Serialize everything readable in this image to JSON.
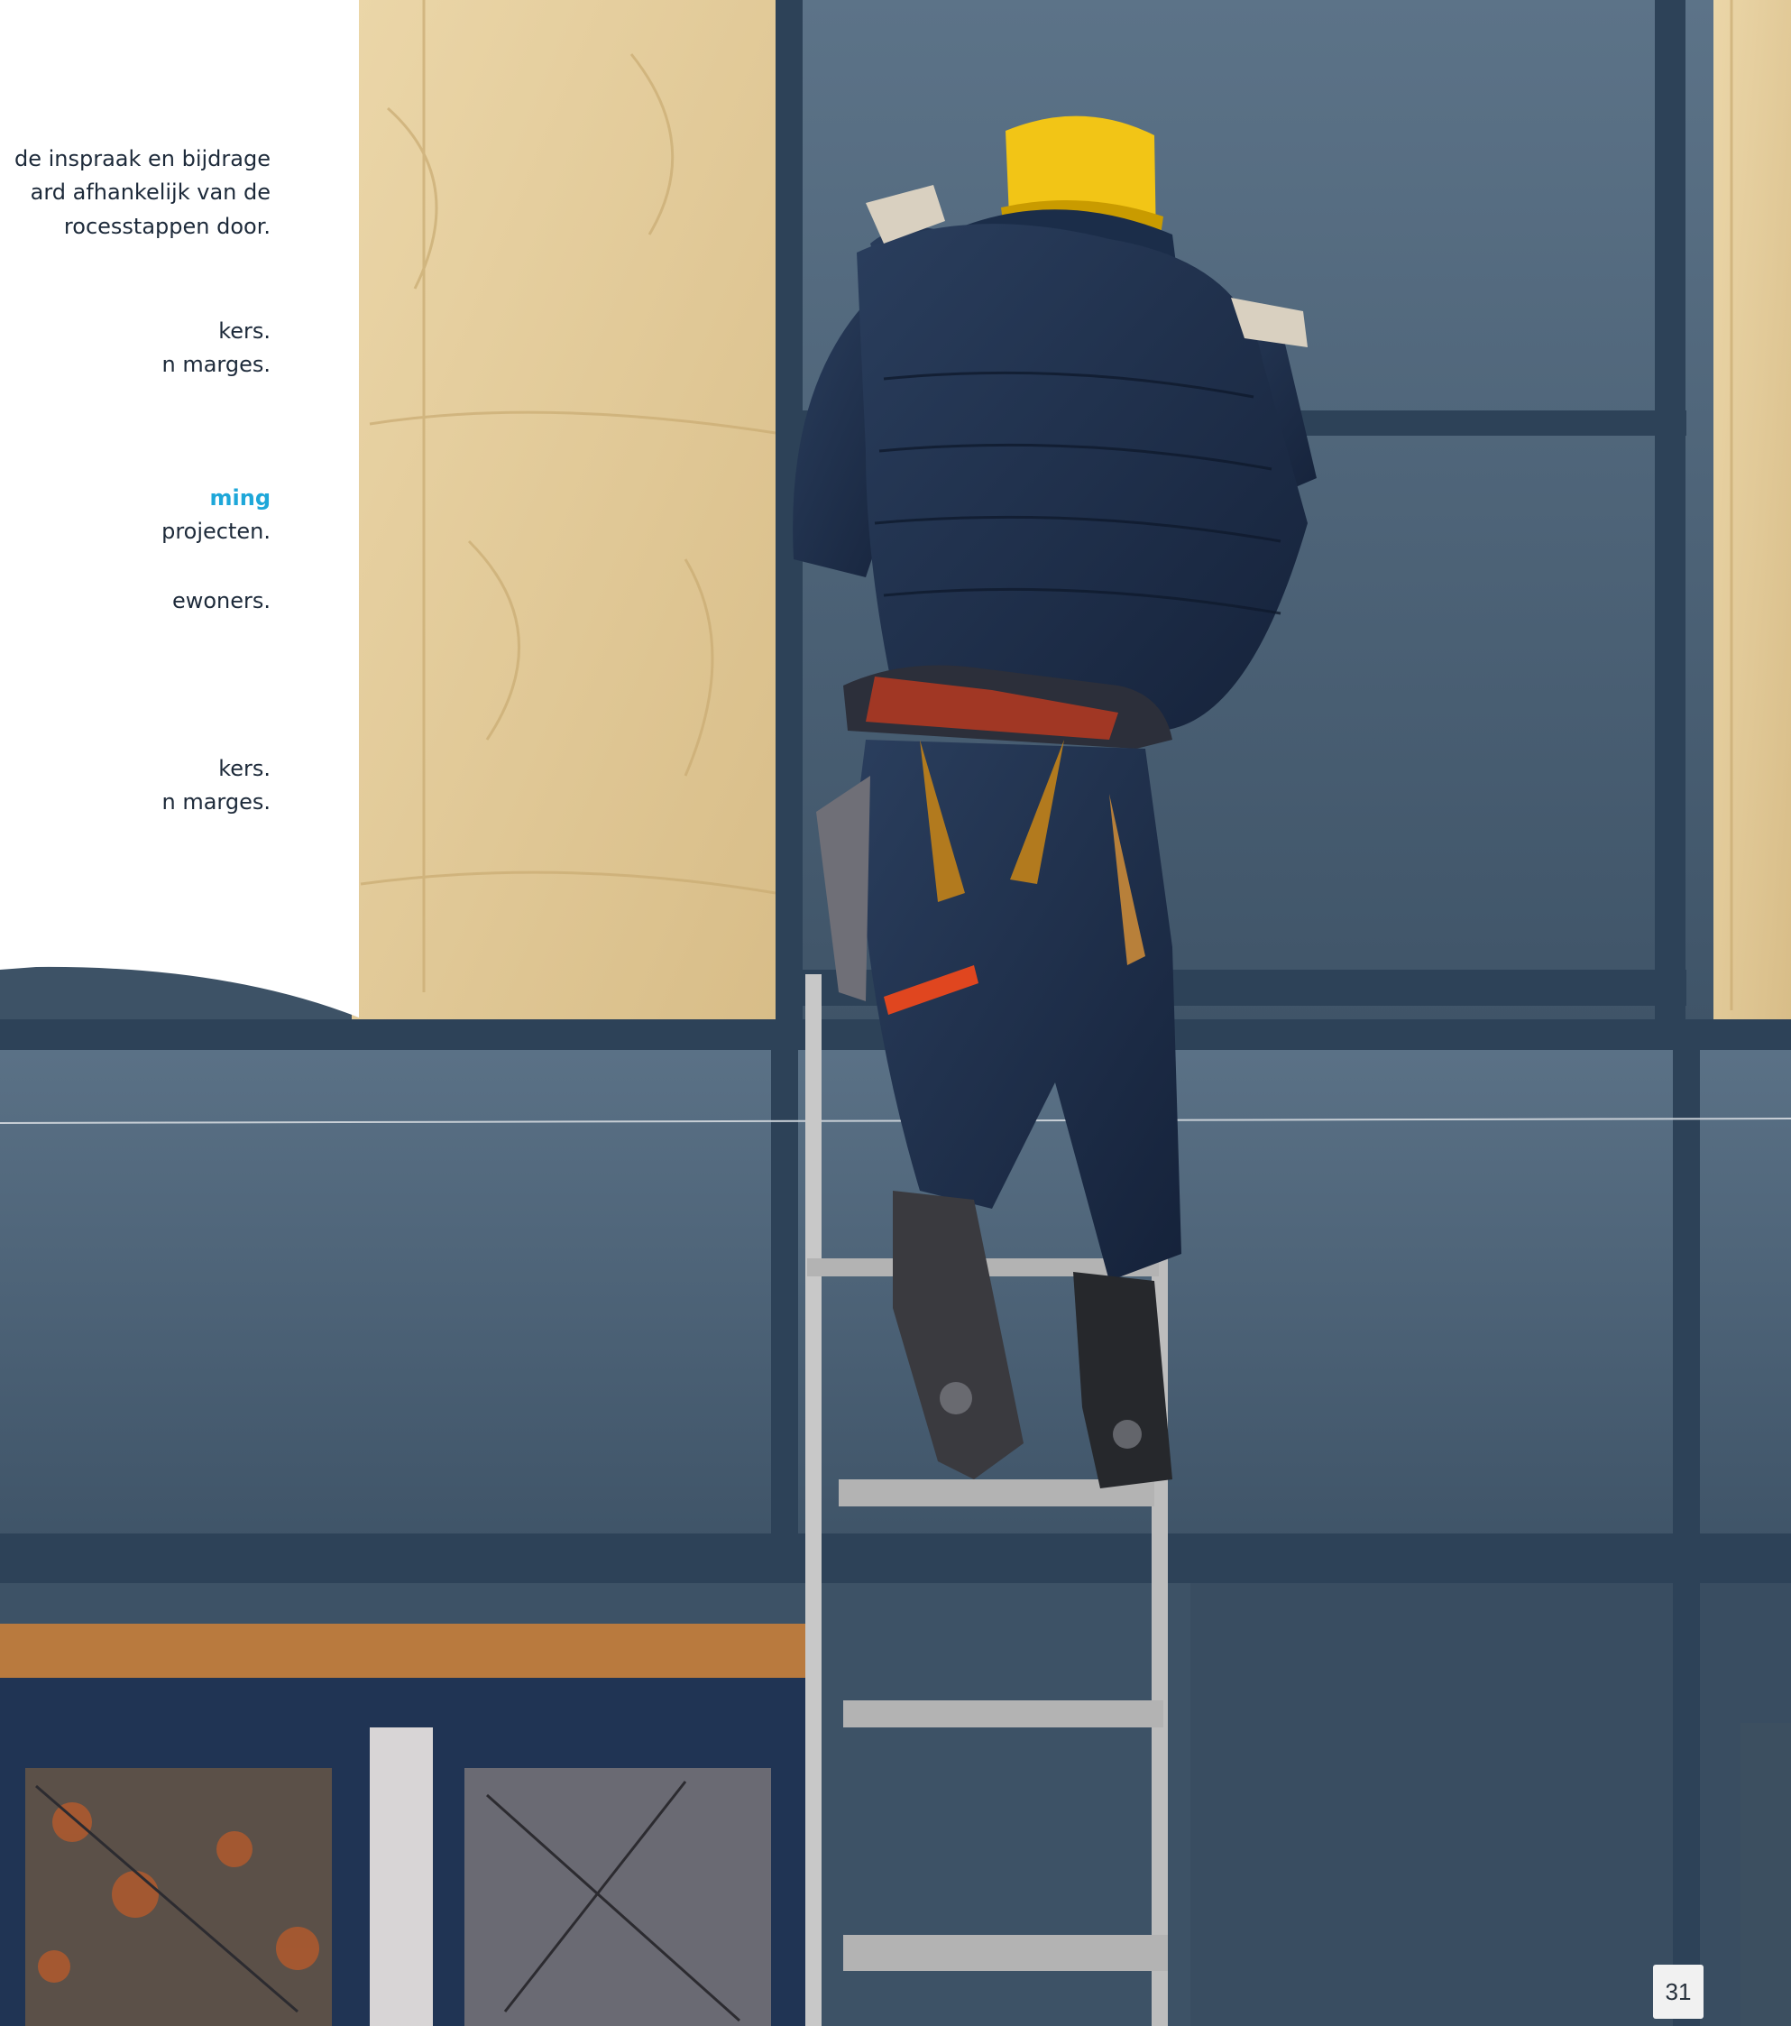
{
  "content": {
    "lines": [
      "de inspraak en bijdrage",
      "ard afhankelijk van de",
      "rocesstappen door.",
      "kers.",
      "n marges.",
      "ming",
      "projecten.",
      "ewoners.",
      "kers.",
      "n marges."
    ]
  },
  "page_number": "31",
  "colors": {
    "accent": "#1ea7d9",
    "text": "#1d2a3a",
    "panel": "#ffffff",
    "page_badge": "#f1f1f1"
  },
  "image": {
    "subject": "worker-on-ladder-facade-insulation"
  }
}
